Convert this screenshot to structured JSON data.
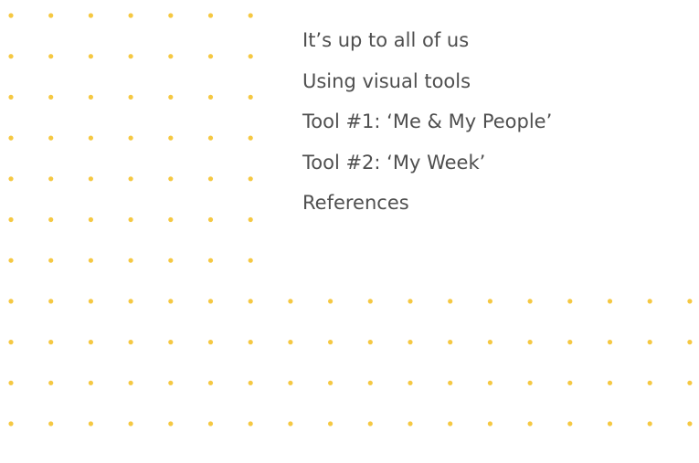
{
  "toc": {
    "items": [
      {
        "label": "It’s up to all of us"
      },
      {
        "label": "Using visual tools"
      },
      {
        "label": "Tool #1: ‘Me & My People’"
      },
      {
        "label": "Tool #2: ‘My Week’"
      },
      {
        "label": "References"
      }
    ]
  },
  "theme": {
    "dot_color": "#f5c842",
    "text_color": "#4f4f4f",
    "background": "#ffffff"
  }
}
